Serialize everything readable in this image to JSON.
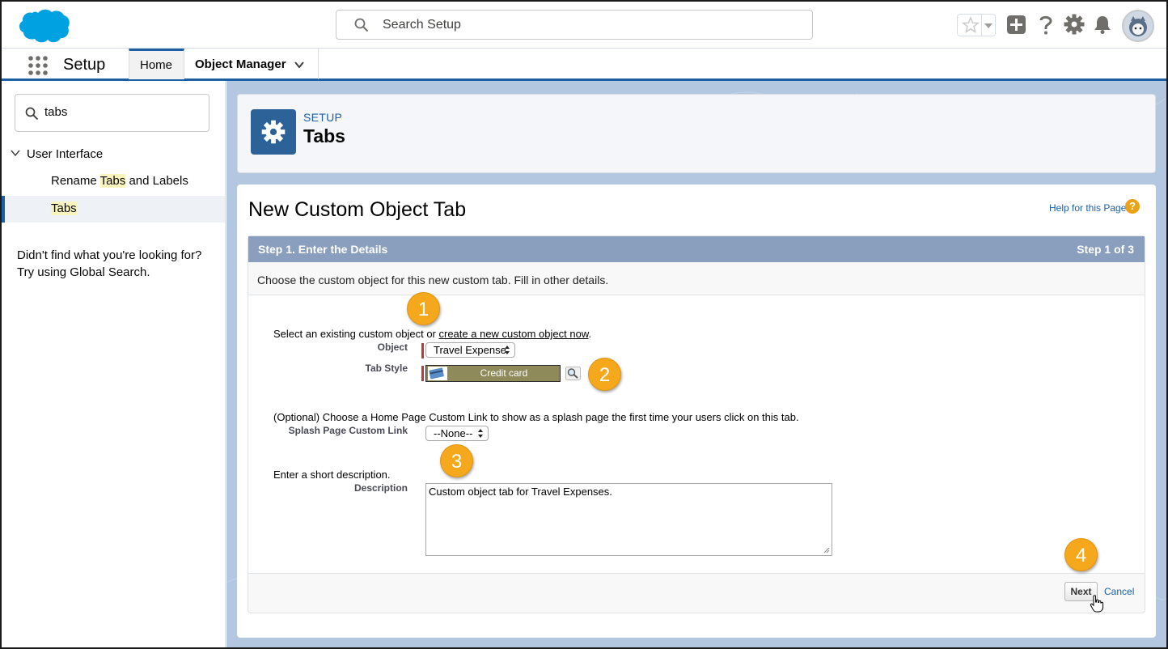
{
  "header": {
    "search_placeholder": "Search Setup"
  },
  "nav": {
    "app_name": "Setup",
    "tabs": [
      {
        "label": "Home"
      },
      {
        "label": "Object Manager"
      }
    ]
  },
  "sidebar": {
    "quick_find_value": "tabs",
    "tree_section": "User Interface",
    "items": [
      {
        "pre": "Rename ",
        "highlight": "Tabs",
        "post": " and Labels"
      },
      {
        "pre": "",
        "highlight": "Tabs",
        "post": ""
      }
    ],
    "hint_line1": "Didn't find what you're looking for?",
    "hint_line2": "Try using Global Search."
  },
  "page_header": {
    "breadcrumb": "SETUP",
    "title": "Tabs"
  },
  "form": {
    "title": "New Custom Object Tab",
    "help_link": "Help for this Page",
    "help_icon_glyph": "?",
    "step_title": "Step 1. Enter the Details",
    "step_count": "Step 1 of 3",
    "intro": "Choose the custom object for this new custom tab. Fill in other details.",
    "select_object_text": "Select an existing custom object or ",
    "create_link": "create a new custom object now",
    "create_suffix": ".",
    "object_label": "Object",
    "object_value": "Travel Expense",
    "tab_style_label": "Tab Style",
    "tab_style_value": "Credit card",
    "optional_text": "(Optional) Choose a Home Page Custom Link to show as a splash page the first time your users click on this tab.",
    "splash_label": "Splash Page Custom Link",
    "splash_value": "--None--",
    "desc_prompt": "Enter a short description.",
    "desc_label": "Description",
    "desc_value": "Custom object tab for Travel Expenses.",
    "next_label": "Next",
    "cancel_label": "Cancel"
  },
  "callouts": [
    "1",
    "2",
    "3",
    "4"
  ],
  "colors": {
    "brand_blue": "#1c5fa3",
    "callout_orange": "#f5a81c",
    "step_header": "#8a9ebe",
    "tab_style_bg": "#8f8a5a",
    "required_red": "#c23934"
  },
  "icons": [
    "salesforce-cloud-logo",
    "search-icon",
    "star-icon",
    "add-icon",
    "help-icon",
    "gear-icon",
    "bell-icon",
    "app-launcher-icon",
    "chevron-down-icon",
    "credit-card-icon",
    "lookup-icon",
    "cursor-hand-icon"
  ]
}
